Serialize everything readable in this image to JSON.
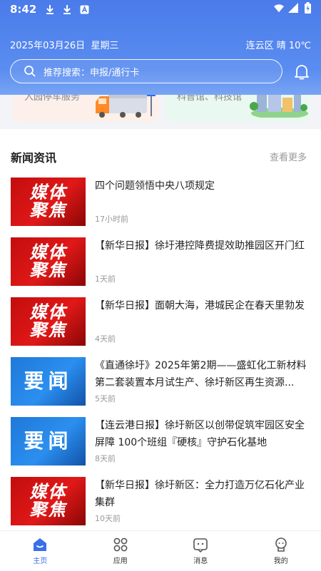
{
  "status_bar": {
    "time": "8:42"
  },
  "header": {
    "date": "2025年03月26日",
    "weekday": "星期三",
    "weather": "连云区 晴 10℃",
    "search_placeholder": "推荐搜索：申报/通行卡"
  },
  "services": [
    {
      "label": "入园停车服务"
    },
    {
      "label": "科普馆、科技馆"
    }
  ],
  "news": {
    "title": "新闻资讯",
    "more": "查看更多",
    "items": [
      {
        "thumb": "媒体聚焦",
        "title": "四个问题领悟中央八项规定",
        "time": "17小时前"
      },
      {
        "thumb": "媒体聚焦",
        "title": "【新华日报】徐圩港控降费提效助推园区开门红",
        "time": "1天前"
      },
      {
        "thumb": "媒体聚焦",
        "title": "【新华日报】面朝大海，港城民企在春天里勃发",
        "time": "4天前"
      },
      {
        "thumb": "要闻",
        "title": "《直通徐圩》2025年第2期——盛虹化工新材料第二套装置本月试生产、徐圩新区再生资源...",
        "time": "5天前"
      },
      {
        "thumb": "要闻",
        "title": "【连云港日报】徐圩新区以创带促筑牢园区安全屏障 100个班组『硬核』守护石化基地",
        "time": "8天前"
      },
      {
        "thumb": "媒体聚焦",
        "title": "【新华日报】徐圩新区：全力打造万亿石化产业集群",
        "time": "10天前"
      }
    ]
  },
  "tabs": [
    {
      "label": "主页",
      "icon": "home-icon"
    },
    {
      "label": "应用",
      "icon": "apps-icon"
    },
    {
      "label": "消息",
      "icon": "message-icon"
    },
    {
      "label": "我的",
      "icon": "profile-icon"
    }
  ],
  "colors": {
    "accent": "#3b6fe6",
    "header": "#5a8df0",
    "media_red": "#d51212",
    "news_blue": "#2182e4"
  }
}
